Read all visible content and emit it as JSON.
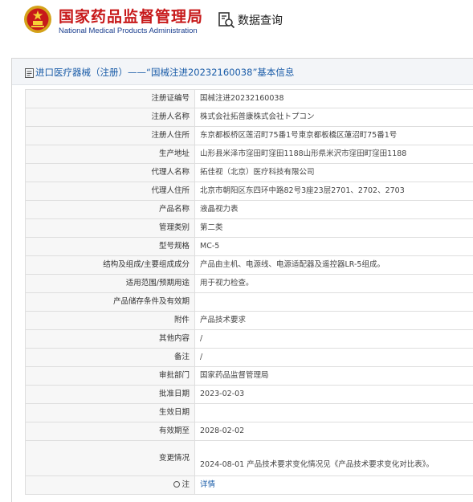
{
  "header": {
    "title_cn": "国家药品监督管理局",
    "title_en": "National Medical Products Administration",
    "query_label": "数据查询",
    "emblem_icon": "national-emblem-icon",
    "query_icon": "document-search-icon"
  },
  "panel": {
    "title": "进口医疗器械（注册）——“国械注进20232160038”基本信息",
    "title_icon": "document-icon"
  },
  "rows": [
    {
      "label": "注册证编号",
      "value": "国械注进20232160038"
    },
    {
      "label": "注册人名称",
      "value": "株式会社拓普康株式会社トプコン"
    },
    {
      "label": "注册人住所",
      "value": "东京都板桥区莲沼町75番1号東京都板橋区蓮沼町75番1号"
    },
    {
      "label": "生产地址",
      "value": "山形县米泽市窪田町窪田1188山形県米沢市窪田町窪田1188"
    },
    {
      "label": "代理人名称",
      "value": "拓佳视（北京）医疗科技有限公司"
    },
    {
      "label": "代理人住所",
      "value": "北京市朝阳区东四环中路82号3座23层2701、2702、2703"
    },
    {
      "label": "产品名称",
      "value": "液晶视力表"
    },
    {
      "label": "管理类别",
      "value": "第二类"
    },
    {
      "label": "型号规格",
      "value": "MC-5"
    },
    {
      "label": "结构及组成/主要组成成分",
      "value": "产品由主机、电源线、电源适配器及遥控器LR-5组成。"
    },
    {
      "label": "适用范围/预期用途",
      "value": "用于视力检查。"
    },
    {
      "label": "产品储存条件及有效期",
      "value": ""
    },
    {
      "label": "附件",
      "value": "产品技术要求"
    },
    {
      "label": "其他内容",
      "value": "/"
    },
    {
      "label": "备注",
      "value": "/"
    },
    {
      "label": "审批部门",
      "value": "国家药品监督管理局"
    },
    {
      "label": "批准日期",
      "value": "2023-02-03"
    },
    {
      "label": "生效日期",
      "value": ""
    },
    {
      "label": "有效期至",
      "value": "2028-02-02"
    },
    {
      "label": "变更情况",
      "value": "2024-08-01 产品技术要求变化情况见《产品技术要求变化对比表》。"
    },
    {
      "label": "注",
      "value": "详情",
      "label_icon": "lightbulb-icon"
    }
  ],
  "colors": {
    "brand_red": "#c7191a",
    "brand_blue": "#1b3f8f",
    "link_blue": "#1a5ca8"
  }
}
